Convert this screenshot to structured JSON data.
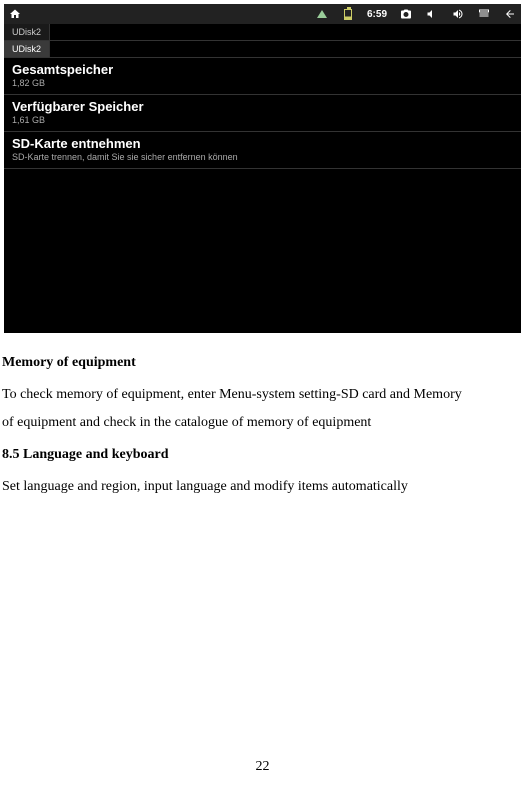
{
  "status_bar": {
    "time": "6:59"
  },
  "tabs": {
    "tab1": "UDisk2",
    "tab2": "UDisk2"
  },
  "storage": {
    "total": {
      "title": "Gesamtspeicher",
      "value": "1,82 GB"
    },
    "available": {
      "title": "Verfügbarer Speicher",
      "value": "1,61 GB"
    },
    "unmount": {
      "title": "SD-Karte entnehmen",
      "subtitle": "SD-Karte trennen, damit Sie sie sicher entfernen können"
    }
  },
  "document": {
    "heading1": "Memory of equipment",
    "para1a": "To check memory of equipment, enter Menu-system setting-SD card and Memory",
    "para1b": "of equipment and check in the catalogue of memory of equipment",
    "heading2": "8.5 Language and keyboard",
    "para2": "Set language and region, input language and modify items automatically",
    "page_number": "22"
  }
}
